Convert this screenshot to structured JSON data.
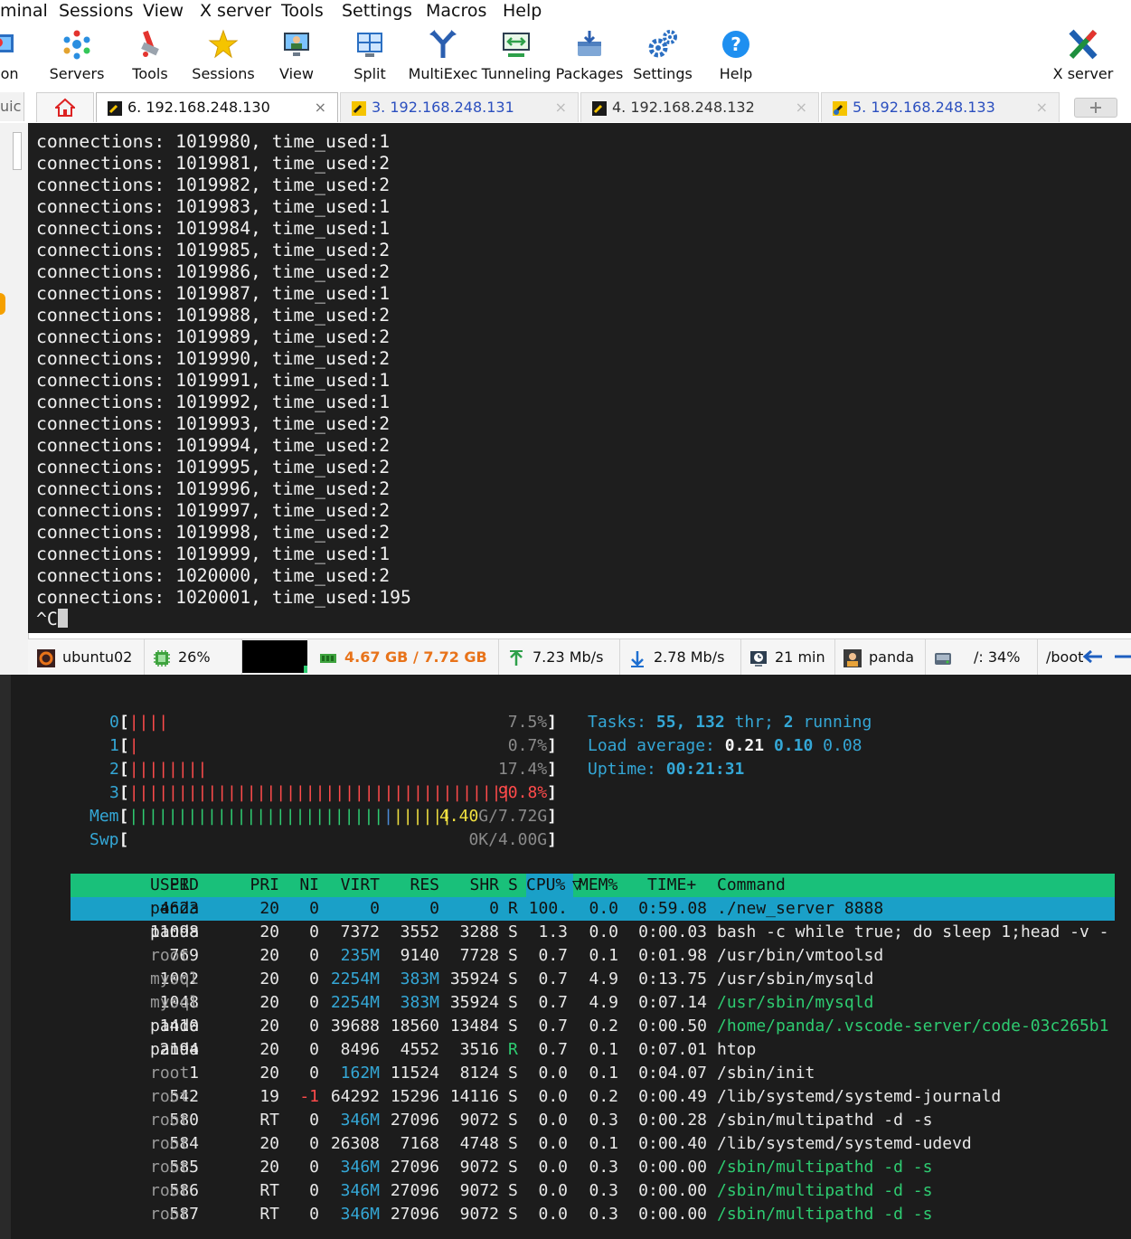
{
  "menubar": {
    "items": [
      "minal",
      "Sessions",
      "View",
      "X server",
      "Tools",
      "Settings",
      "Macros",
      "Help"
    ]
  },
  "toolbar": {
    "items": [
      "ssion",
      "Servers",
      "Tools",
      "Sessions",
      "View",
      "Split",
      "MultiExec",
      "Tunneling",
      "Packages",
      "Settings",
      "Help"
    ],
    "xserver": "X server"
  },
  "tabs": {
    "quick": "uic",
    "items": [
      {
        "label": "6. 192.168.248.130",
        "active": true
      },
      {
        "label": "3. 192.168.248.131",
        "active": false
      },
      {
        "label": "4. 192.168.248.132",
        "active": false
      },
      {
        "label": "5. 192.168.248.133",
        "active": false
      }
    ],
    "close": "×"
  },
  "terminal": {
    "lines": [
      "connections: 1019980, time_used:1",
      "connections: 1019981, time_used:2",
      "connections: 1019982, time_used:2",
      "connections: 1019983, time_used:1",
      "connections: 1019984, time_used:1",
      "connections: 1019985, time_used:2",
      "connections: 1019986, time_used:2",
      "connections: 1019987, time_used:1",
      "connections: 1019988, time_used:2",
      "connections: 1019989, time_used:2",
      "connections: 1019990, time_used:2",
      "connections: 1019991, time_used:1",
      "connections: 1019992, time_used:1",
      "connections: 1019993, time_used:2",
      "connections: 1019994, time_used:2",
      "connections: 1019995, time_used:2",
      "connections: 1019996, time_used:2",
      "connections: 1019997, time_used:2",
      "connections: 1019998, time_used:2",
      "connections: 1019999, time_used:1",
      "connections: 1020000, time_used:2",
      "connections: 1020001, time_used:195"
    ],
    "prompt": "^C"
  },
  "statusbar": {
    "host": "ubuntu02",
    "cpu": "26%",
    "memory": "4.67 GB / 7.72 GB",
    "upload": "7.23 Mb/s",
    "download": "2.78 Mb/s",
    "uptime": "21 min",
    "user": "panda",
    "disk": "/: 34%",
    "boot": "/boot"
  },
  "htop": {
    "cpus": [
      {
        "label": "0",
        "value": "7.5%",
        "bars": 4
      },
      {
        "label": "1",
        "value": "0.7%",
        "bars": 1
      },
      {
        "label": "2",
        "value": "17.4%",
        "bars": 8
      },
      {
        "label": "3",
        "value": "90.8%",
        "bars": 39
      }
    ],
    "mem": {
      "label": "Mem",
      "value_used": "4.40",
      "value_rest": "G/7.72G",
      "green_bars": 26,
      "blue_bars": 1,
      "yellow_bars": 6
    },
    "swp": {
      "label": "Swp",
      "value": "0K/4.00G"
    },
    "tasks_label": "Tasks:",
    "tasks_value": "55, 132",
    "tasks_thr": "thr;",
    "tasks_running": "2",
    "tasks_running_label": "running",
    "load_label": "Load average:",
    "load_1": "0.21",
    "load_5": "0.10",
    "load_15": "0.08",
    "uptime_label": "Uptime:",
    "uptime_value": "00:21:31",
    "columns": [
      "PID",
      "USER",
      "PRI",
      "NI",
      "VIRT",
      "RES",
      "SHR",
      "S",
      "CPU%",
      "MEM%",
      "TIME+",
      "Command"
    ],
    "processes": [
      {
        "pid": "4623",
        "user": "panda",
        "pri": "20",
        "ni": "0",
        "virt": "0",
        "res": "0",
        "shr": "0",
        "s": "R",
        "cpu": "100.",
        "mem": "0.0",
        "time": "0:59.08",
        "cmd": "./new_server 8888"
      },
      {
        "pid": "11098",
        "user": "panda",
        "pri": "20",
        "ni": "0",
        "virt": "7372",
        "res": "3552",
        "shr": "3288",
        "s": "S",
        "cpu": "1.3",
        "mem": "0.0",
        "time": "0:00.03",
        "cmd": "bash -c while true; do sleep 1;head -v -"
      },
      {
        "pid": "769",
        "user": "root",
        "pri": "20",
        "ni": "0",
        "virt": "235M",
        "res": "9140",
        "shr": "7728",
        "s": "S",
        "cpu": "0.7",
        "mem": "0.1",
        "time": "0:01.98",
        "cmd": "/usr/bin/vmtoolsd"
      },
      {
        "pid": "1002",
        "user": "mysql",
        "pri": "20",
        "ni": "0",
        "virt": "2254M",
        "res": "383M",
        "shr": "35924",
        "s": "S",
        "cpu": "0.7",
        "mem": "4.9",
        "time": "0:13.75",
        "cmd": "/usr/sbin/mysqld"
      },
      {
        "pid": "1048",
        "user": "mysql",
        "pri": "20",
        "ni": "0",
        "virt": "2254M",
        "res": "383M",
        "shr": "35924",
        "s": "S",
        "cpu": "0.7",
        "mem": "4.9",
        "time": "0:07.14",
        "cmd": "/usr/sbin/mysqld"
      },
      {
        "pid": "1410",
        "user": "panda",
        "pri": "20",
        "ni": "0",
        "virt": "39688",
        "res": "18560",
        "shr": "13484",
        "s": "S",
        "cpu": "0.7",
        "mem": "0.2",
        "time": "0:00.50",
        "cmd": "/home/panda/.vscode-server/code-03c265b1"
      },
      {
        "pid": "2194",
        "user": "panda",
        "pri": "20",
        "ni": "0",
        "virt": "8496",
        "res": "4552",
        "shr": "3516",
        "s": "R",
        "cpu": "0.7",
        "mem": "0.1",
        "time": "0:07.01",
        "cmd": "htop"
      },
      {
        "pid": "1",
        "user": "root",
        "pri": "20",
        "ni": "0",
        "virt": "162M",
        "res": "11524",
        "shr": "8124",
        "s": "S",
        "cpu": "0.0",
        "mem": "0.1",
        "time": "0:04.07",
        "cmd": "/sbin/init"
      },
      {
        "pid": "542",
        "user": "root",
        "pri": "19",
        "ni": "-1",
        "virt": "64292",
        "res": "15296",
        "shr": "14116",
        "s": "S",
        "cpu": "0.0",
        "mem": "0.2",
        "time": "0:00.49",
        "cmd": "/lib/systemd/systemd-journald"
      },
      {
        "pid": "580",
        "user": "root",
        "pri": "RT",
        "ni": "0",
        "virt": "346M",
        "res": "27096",
        "shr": "9072",
        "s": "S",
        "cpu": "0.0",
        "mem": "0.3",
        "time": "0:00.28",
        "cmd": "/sbin/multipathd -d -s"
      },
      {
        "pid": "584",
        "user": "root",
        "pri": "20",
        "ni": "0",
        "virt": "26308",
        "res": "7168",
        "shr": "4748",
        "s": "S",
        "cpu": "0.0",
        "mem": "0.1",
        "time": "0:00.40",
        "cmd": "/lib/systemd/systemd-udevd"
      },
      {
        "pid": "585",
        "user": "root",
        "pri": "20",
        "ni": "0",
        "virt": "346M",
        "res": "27096",
        "shr": "9072",
        "s": "S",
        "cpu": "0.0",
        "mem": "0.3",
        "time": "0:00.00",
        "cmd": "/sbin/multipathd -d -s"
      },
      {
        "pid": "586",
        "user": "root",
        "pri": "RT",
        "ni": "0",
        "virt": "346M",
        "res": "27096",
        "shr": "9072",
        "s": "S",
        "cpu": "0.0",
        "mem": "0.3",
        "time": "0:00.00",
        "cmd": "/sbin/multipathd -d -s"
      },
      {
        "pid": "587",
        "user": "root",
        "pri": "RT",
        "ni": "0",
        "virt": "346M",
        "res": "27096",
        "shr": "9072",
        "s": "S",
        "cpu": "0.0",
        "mem": "0.3",
        "time": "0:00.00",
        "cmd": "/sbin/multipathd -d -s"
      }
    ]
  },
  "colors": {
    "header_bg": "#19c07a",
    "selected_row": "#1aa0c8",
    "cpu_bar": "#ff4b4b",
    "mem_bar": "#2ecc71",
    "accent_orange": "#e8731a"
  }
}
